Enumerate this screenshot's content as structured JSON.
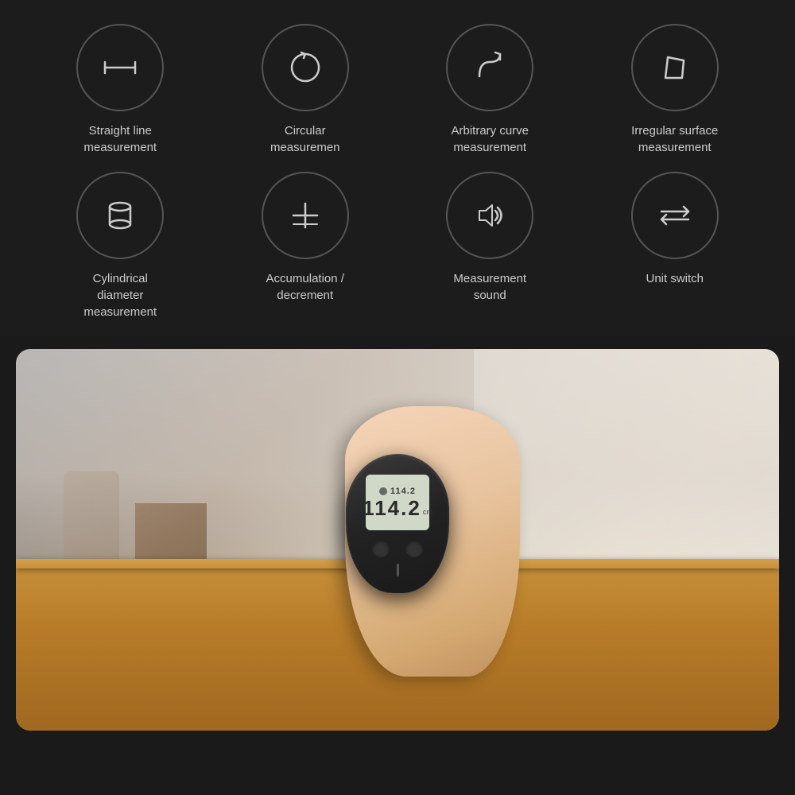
{
  "background": "#1c1c1c",
  "icons": [
    {
      "id": "straight-line",
      "label": "Straight line\nmeasurement",
      "label_line1": "Straight line",
      "label_line2": "measurement",
      "icon": "straight-line-icon"
    },
    {
      "id": "circular",
      "label": "Circular\nmeasuremen",
      "label_line1": "Circular",
      "label_line2": "measuremen",
      "icon": "circular-icon"
    },
    {
      "id": "arbitrary-curve",
      "label": "Arbitrary curve\nmeasurement",
      "label_line1": "Arbitrary curve",
      "label_line2": "measurement",
      "icon": "arbitrary-curve-icon"
    },
    {
      "id": "irregular-surface",
      "label": "Irregular surface\nmeasurement",
      "label_line1": "Irregular surface",
      "label_line2": "measurement",
      "icon": "irregular-surface-icon"
    },
    {
      "id": "cylindrical",
      "label": "Cylindrical\ndiameter\nmeasurement",
      "label_line1": "Cylindrical",
      "label_line2": "diameter",
      "label_line3": "measurement",
      "icon": "cylindrical-icon"
    },
    {
      "id": "accumulation",
      "label": "Accumulation /\ndecrement",
      "label_line1": "Accumulation /",
      "label_line2": "decrement",
      "icon": "accumulation-icon"
    },
    {
      "id": "sound",
      "label": "Measurement\nsound",
      "label_line1": "Measurement",
      "label_line2": "sound",
      "icon": "sound-icon"
    },
    {
      "id": "unit-switch",
      "label": "Unit switch",
      "label_line1": "Unit switch",
      "label_line2": "",
      "icon": "unit-switch-icon"
    }
  ],
  "device": {
    "screen_value_small": "114.2",
    "screen_value_large": "114.2",
    "unit": "cm"
  }
}
